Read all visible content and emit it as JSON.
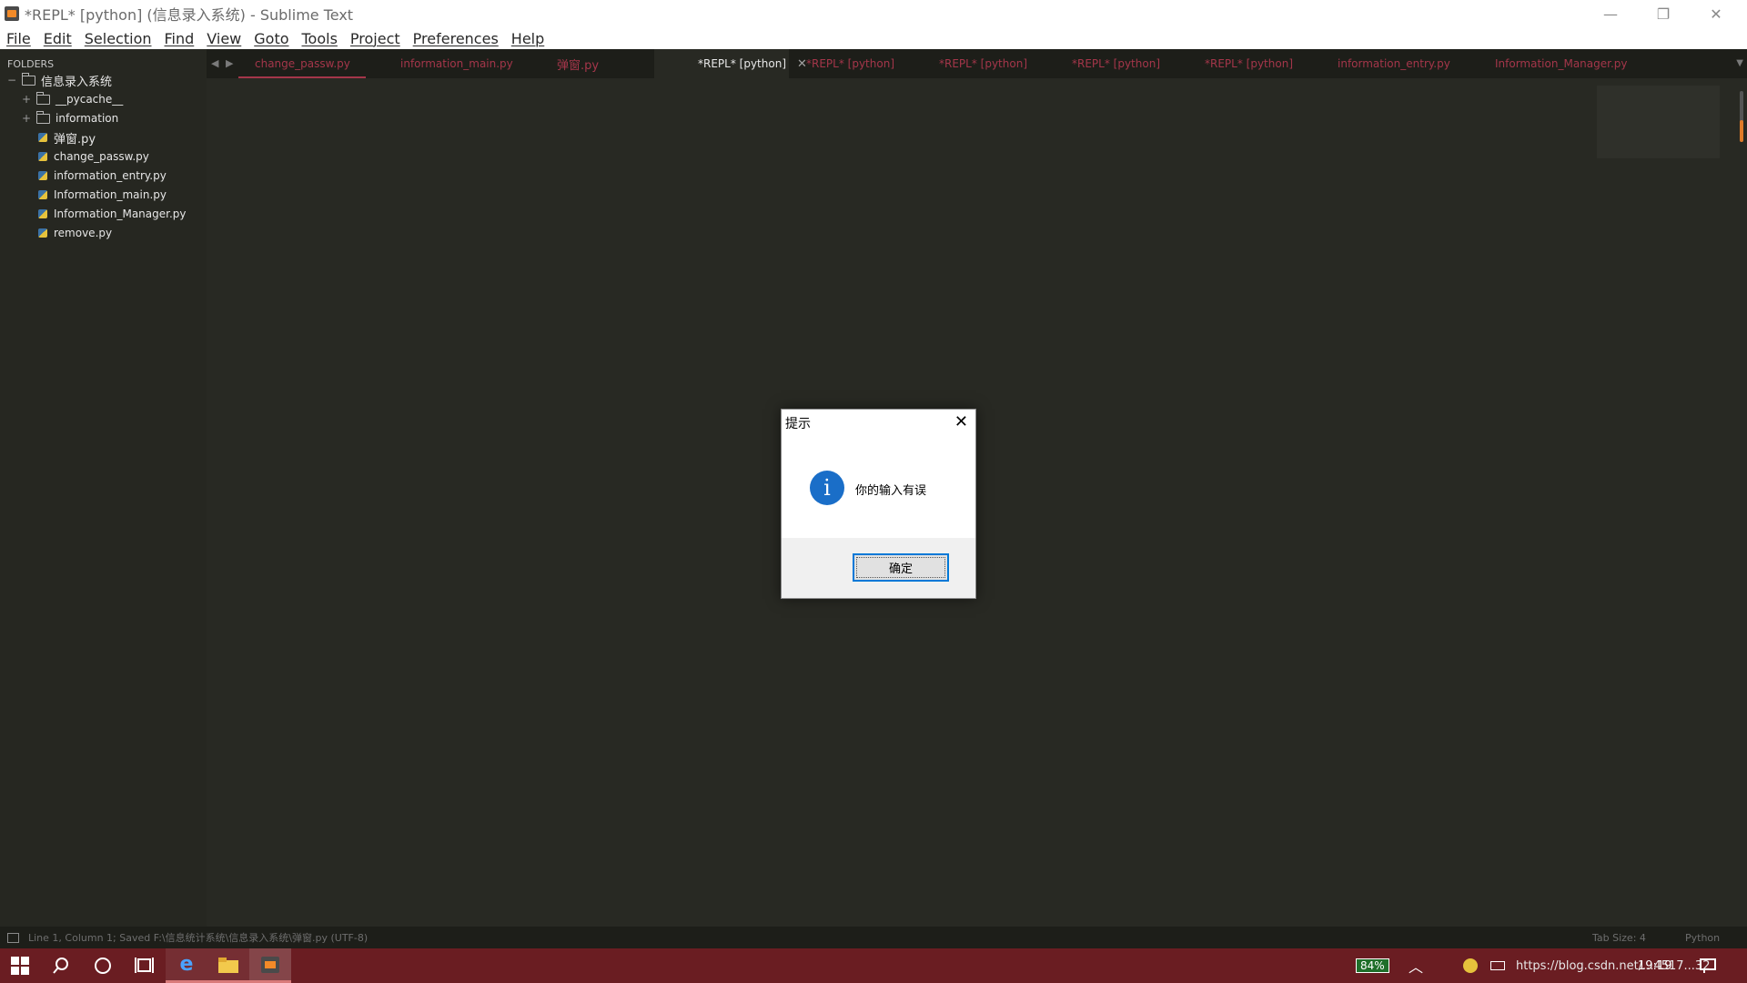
{
  "window": {
    "title": "*REPL* [python] (信息录入系统) - Sublime Text",
    "minimize": "—",
    "restore": "❐",
    "close": "✕"
  },
  "menu": [
    "File",
    "Edit",
    "Selection",
    "Find",
    "View",
    "Goto",
    "Tools",
    "Project",
    "Preferences",
    "Help"
  ],
  "sidebar": {
    "label": "FOLDERS",
    "root": "信息录入系统",
    "folders": [
      "__pycache__",
      "information"
    ],
    "files": [
      "弹窗.py",
      "change_passw.py",
      "information_entry.py",
      "Information_main.py",
      "Information_Manager.py",
      "remove.py"
    ]
  },
  "tabs": [
    {
      "label": "change_passw.py"
    },
    {
      "label": "information_main.py"
    },
    {
      "label": "弹窗.py"
    },
    {
      "label": "*REPL* [python]",
      "active": true
    },
    {
      "label": "*REPL* [python]"
    },
    {
      "label": "*REPL* [python]"
    },
    {
      "label": "*REPL* [python]"
    },
    {
      "label": "*REPL* [python]"
    },
    {
      "label": "information_entry.py"
    },
    {
      "label": "Information_Manager.py"
    }
  ],
  "status": {
    "left": "Line 1, Column 1; Saved F:\\信息统计系统\\信息录入系统\\弹窗.py (UTF-8)",
    "tab_size": "Tab Size: 4",
    "syntax": "Python"
  },
  "dialog": {
    "title": "提示",
    "message": "你的输入有误",
    "ok": "确定",
    "icon": "info-icon"
  },
  "taskbar": {
    "battery": "84%",
    "tray_text": "https://blog.csdn.net/...4517...32",
    "time": "19:19"
  },
  "colors": {
    "editor_bg": "#282923",
    "sidebar_bg": "#262721",
    "tab_text": "#a4364a",
    "taskbar_bg": "#6a1d22",
    "accent": "#0078d7"
  }
}
